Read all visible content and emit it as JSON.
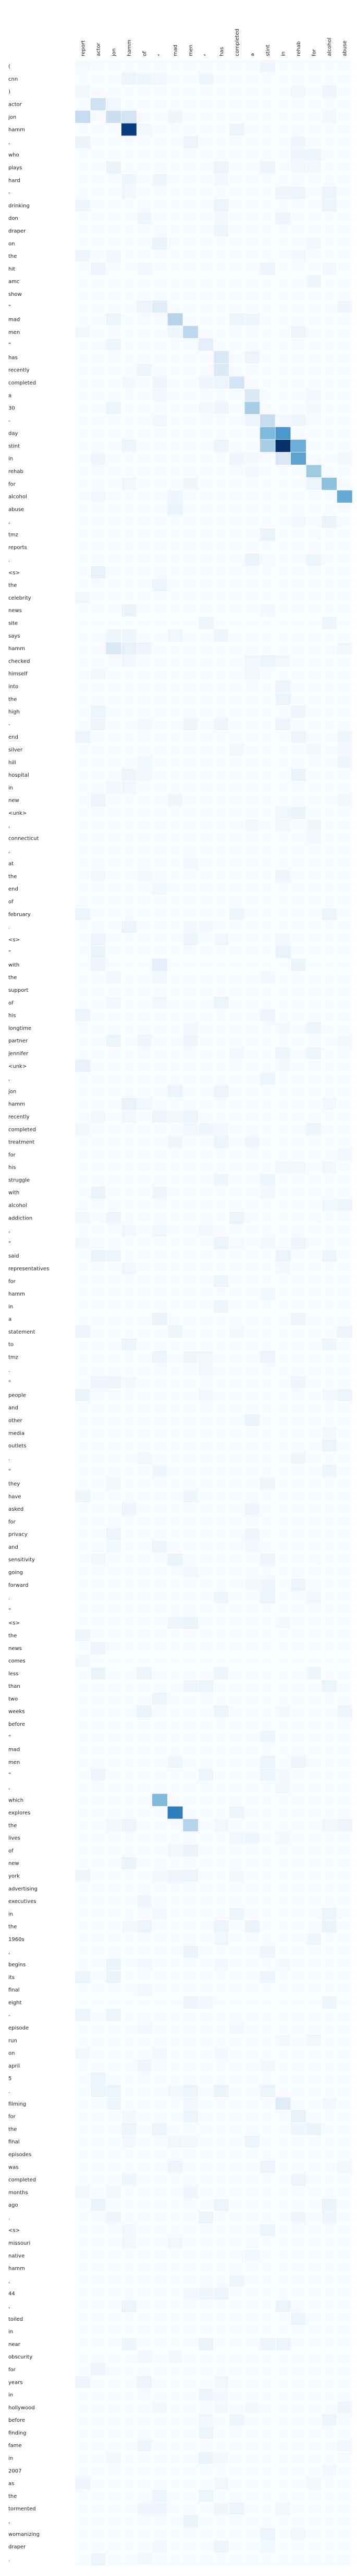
{
  "chart_data": {
    "type": "heatmap",
    "title": "",
    "xlabel": "",
    "ylabel": "",
    "colormap": "Blues",
    "grid": true,
    "value_range": [
      0,
      1
    ],
    "x_labels": [
      "report",
      "actor",
      "jon",
      "hamm",
      "of",
      "“",
      "mad",
      "men",
      "”",
      "has",
      "completed",
      "a",
      "stint",
      "in",
      "rehab",
      "for",
      "alcohol",
      "abuse"
    ],
    "y_labels": [
      "(",
      "cnn",
      ")",
      "actor",
      "jon",
      "hamm",
      ",",
      "who",
      "plays",
      "hard",
      "-",
      "drinking",
      "don",
      "draper",
      "on",
      "the",
      "hit",
      "amc",
      "show",
      "“",
      "mad",
      "men",
      "”",
      "has",
      "recently",
      "completed",
      "a",
      "30",
      "-",
      "day",
      "stint",
      "in",
      "rehab",
      "for",
      "alcohol",
      "abuse",
      ",",
      "tmz",
      "reports",
      ".",
      "<s>",
      "the",
      "celebrity",
      "news",
      "site",
      "says",
      "hamm",
      "checked",
      "himself",
      "into",
      "the",
      "high",
      "-",
      "end",
      "silver",
      "hill",
      "hospital",
      "in",
      "new",
      "<unk>",
      ",",
      "connecticut",
      ",",
      "at",
      "the",
      "end",
      "of",
      "february",
      ".",
      "<s>",
      "“",
      "with",
      "the",
      "support",
      "of",
      "his",
      "longtime",
      "partner",
      "jennifer",
      "<unk>",
      ",",
      "jon",
      "hamm",
      "recently",
      "completed",
      "treatment",
      "for",
      "his",
      "struggle",
      "with",
      "alcohol",
      "addiction",
      ",",
      "”",
      "said",
      "representatives",
      "for",
      "hamm",
      "in",
      "a",
      "statement",
      "to",
      "tmz",
      ".",
      "“",
      "people",
      "and",
      "other",
      "media",
      "outlets",
      ".",
      "“",
      "they",
      "have",
      "asked",
      "for",
      "privacy",
      "and",
      "sensitivity",
      "going",
      "forward",
      ".",
      "”",
      "<s>",
      "the",
      "news",
      "comes",
      "less",
      "than",
      "two",
      "weeks",
      "before",
      "“",
      "mad",
      "men",
      "”",
      ",",
      "which",
      "explores",
      "the",
      "lives",
      "of",
      "new",
      "york",
      "advertising",
      "executives",
      "in",
      "the",
      "1960s",
      ",",
      "begins",
      "its",
      "final",
      "eight",
      "-",
      "episode",
      "run",
      "on",
      "april",
      "5",
      ".",
      "filming",
      "for",
      "the",
      "final",
      "episodes",
      "was",
      "completed",
      "months",
      "ago",
      ".",
      "<s>",
      "missouri",
      "native",
      "hamm",
      ",",
      "44",
      ",",
      "toiled",
      "in",
      "near",
      "obscurity",
      "for",
      "years",
      "in",
      "hollywood",
      "before",
      "finding",
      "fame",
      "in",
      "2007",
      "as",
      "the",
      "tormented",
      ",",
      "womanizing",
      "draper",
      "."
    ],
    "strong_cells": [
      {
        "row": 3,
        "col": 1,
        "value": 0.2
      },
      {
        "row": 4,
        "col": 0,
        "value": 0.25
      },
      {
        "row": 4,
        "col": 2,
        "value": 0.22
      },
      {
        "row": 4,
        "col": 3,
        "value": 0.18
      },
      {
        "row": 5,
        "col": 3,
        "value": 0.95
      },
      {
        "row": 8,
        "col": 2,
        "value": 0.06
      },
      {
        "row": 19,
        "col": 5,
        "value": 0.12
      },
      {
        "row": 20,
        "col": 6,
        "value": 0.3
      },
      {
        "row": 21,
        "col": 7,
        "value": 0.28
      },
      {
        "row": 22,
        "col": 8,
        "value": 0.1
      },
      {
        "row": 23,
        "col": 9,
        "value": 0.15
      },
      {
        "row": 24,
        "col": 9,
        "value": 0.14
      },
      {
        "row": 25,
        "col": 10,
        "value": 0.18
      },
      {
        "row": 26,
        "col": 11,
        "value": 0.14
      },
      {
        "row": 27,
        "col": 11,
        "value": 0.35
      },
      {
        "row": 28,
        "col": 12,
        "value": 0.25
      },
      {
        "row": 29,
        "col": 12,
        "value": 0.45
      },
      {
        "row": 29,
        "col": 13,
        "value": 0.6
      },
      {
        "row": 30,
        "col": 12,
        "value": 0.35
      },
      {
        "row": 30,
        "col": 13,
        "value": 1.0
      },
      {
        "row": 30,
        "col": 14,
        "value": 0.5
      },
      {
        "row": 31,
        "col": 13,
        "value": 0.15
      },
      {
        "row": 31,
        "col": 14,
        "value": 0.55
      },
      {
        "row": 32,
        "col": 15,
        "value": 0.38
      },
      {
        "row": 33,
        "col": 16,
        "value": 0.42
      },
      {
        "row": 34,
        "col": 17,
        "value": 0.52
      },
      {
        "row": 35,
        "col": 18,
        "value": 0.78
      },
      {
        "row": 36,
        "col": 19,
        "value": 0.24
      },
      {
        "row": 40,
        "col": 1,
        "value": 0.08
      },
      {
        "row": 46,
        "col": 2,
        "value": 0.15
      },
      {
        "row": 46,
        "col": 3,
        "value": 0.08
      },
      {
        "row": 70,
        "col": 1,
        "value": 0.06
      },
      {
        "row": 71,
        "col": 5,
        "value": 0.1
      },
      {
        "row": 79,
        "col": 0,
        "value": 0.08
      },
      {
        "row": 82,
        "col": 3,
        "value": 0.07
      },
      {
        "row": 93,
        "col": 18,
        "value": 0.15
      },
      {
        "row": 94,
        "col": 19,
        "value": 0.1
      },
      {
        "row": 127,
        "col": 1,
        "value": 0.06
      },
      {
        "row": 137,
        "col": 5,
        "value": 0.45
      },
      {
        "row": 138,
        "col": 6,
        "value": 0.7
      },
      {
        "row": 139,
        "col": 7,
        "value": 0.3
      },
      {
        "row": 161,
        "col": 13,
        "value": 0.12
      },
      {
        "row": 162,
        "col": 14,
        "value": 0.08
      },
      {
        "row": 163,
        "col": 15,
        "value": 0.06
      }
    ]
  }
}
